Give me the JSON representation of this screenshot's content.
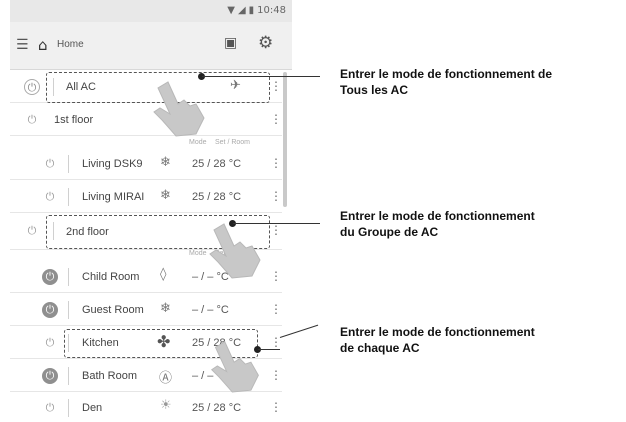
{
  "status": {
    "time": "10:48"
  },
  "appbar": {
    "title": "Home"
  },
  "columns": {
    "mode": "Mode",
    "set_room": "Set / Room",
    "mode2": "Mode",
    "set_room2": "Set / Room"
  },
  "rows": [
    {
      "label": "All AC"
    },
    {
      "label": "1st floor"
    },
    {
      "label": "Living DSK9",
      "temp": "25 / 28 °C"
    },
    {
      "label": "Living MIRAI",
      "temp": "25 / 28 °C"
    },
    {
      "label": "2nd floor"
    },
    {
      "label": "Child Room",
      "temp": "– / –  °C"
    },
    {
      "label": "Guest Room",
      "temp": "– / –  °C"
    },
    {
      "label": "Kitchen",
      "temp": "25 / 28 °C"
    },
    {
      "label": "Bath Room",
      "temp": "– / –  °C"
    },
    {
      "label": "Den",
      "temp": "25 / 28 °C"
    }
  ],
  "callouts": [
    {
      "line1": "Entrer le mode de fonctionnement de",
      "line2": "Tous les AC"
    },
    {
      "line1": "Entrer le mode de fonctionnement",
      "line2": "du Groupe de AC"
    },
    {
      "line1": "Entrer le mode de fonctionnement",
      "line2": "de chaque AC"
    }
  ]
}
